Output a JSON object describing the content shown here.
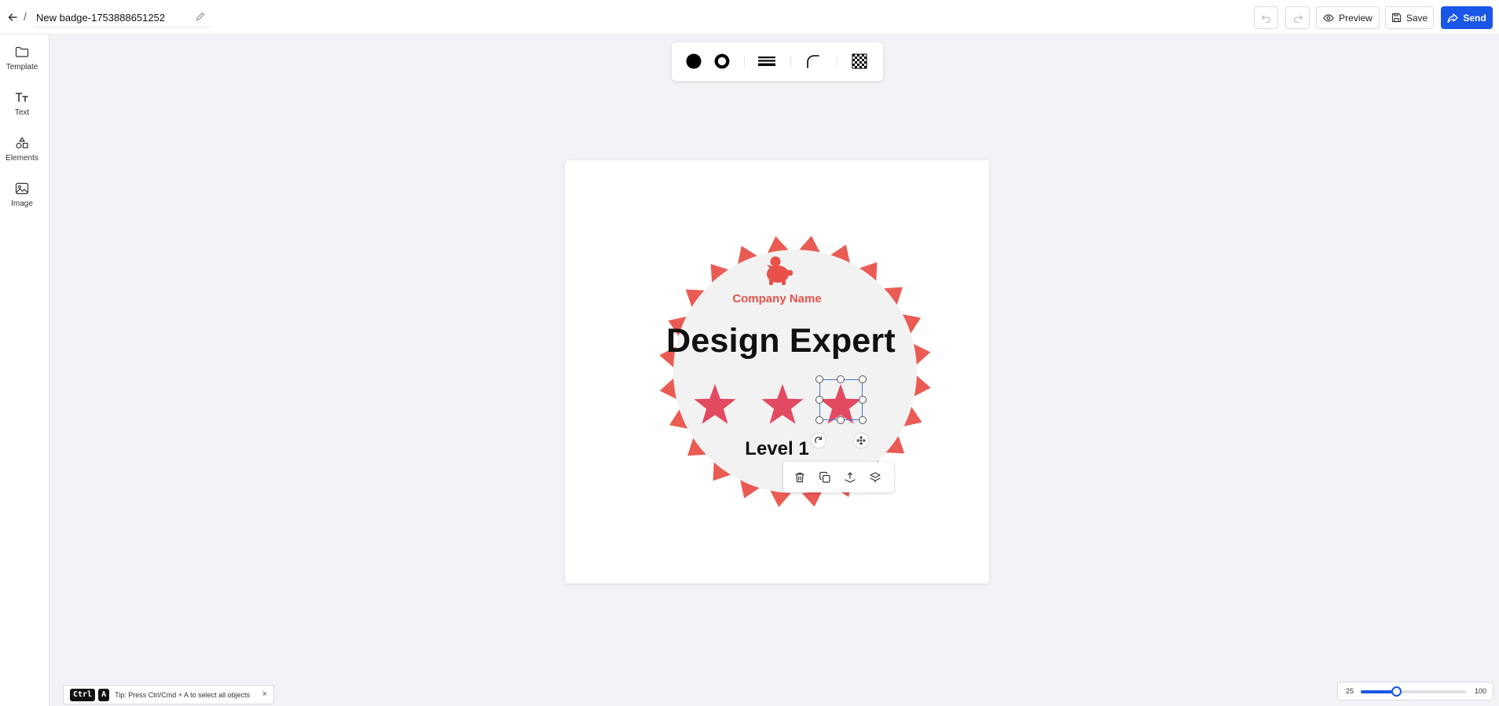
{
  "header": {
    "separator": "/",
    "title": "New badge-1753888651252",
    "buttons": {
      "preview": "Preview",
      "save": "Save",
      "send": "Send"
    }
  },
  "sidebar": {
    "items": [
      {
        "label": "Template",
        "icon": "folder-icon"
      },
      {
        "label": "Text",
        "icon": "text-icon"
      },
      {
        "label": "Elements",
        "icon": "shapes-icon"
      },
      {
        "label": "Image",
        "icon": "image-icon"
      }
    ]
  },
  "shape_toolbar": {
    "tools": [
      "fill-circle-icon",
      "ring-icon",
      "border-lines-icon",
      "corner-radius-icon",
      "transparency-icon"
    ]
  },
  "badge": {
    "company": "Company Name",
    "headline": "Design Expert",
    "level": "Level 1",
    "colors": {
      "outer": "#ea5b54",
      "inner": "#f2f2f2",
      "star": "#e24a62",
      "logo": "#e8514a"
    }
  },
  "object_toolbar": {
    "tools": [
      "trash-icon",
      "duplicate-icon",
      "bring-forward-icon",
      "send-backward-icon"
    ]
  },
  "tip": {
    "key1": "Ctrl",
    "key2": "A",
    "text": "Tip: Press Ctrl/Cmd + A to select all objects",
    "close": "×"
  },
  "zoom": {
    "min": "25",
    "max": "100",
    "value": 50
  }
}
